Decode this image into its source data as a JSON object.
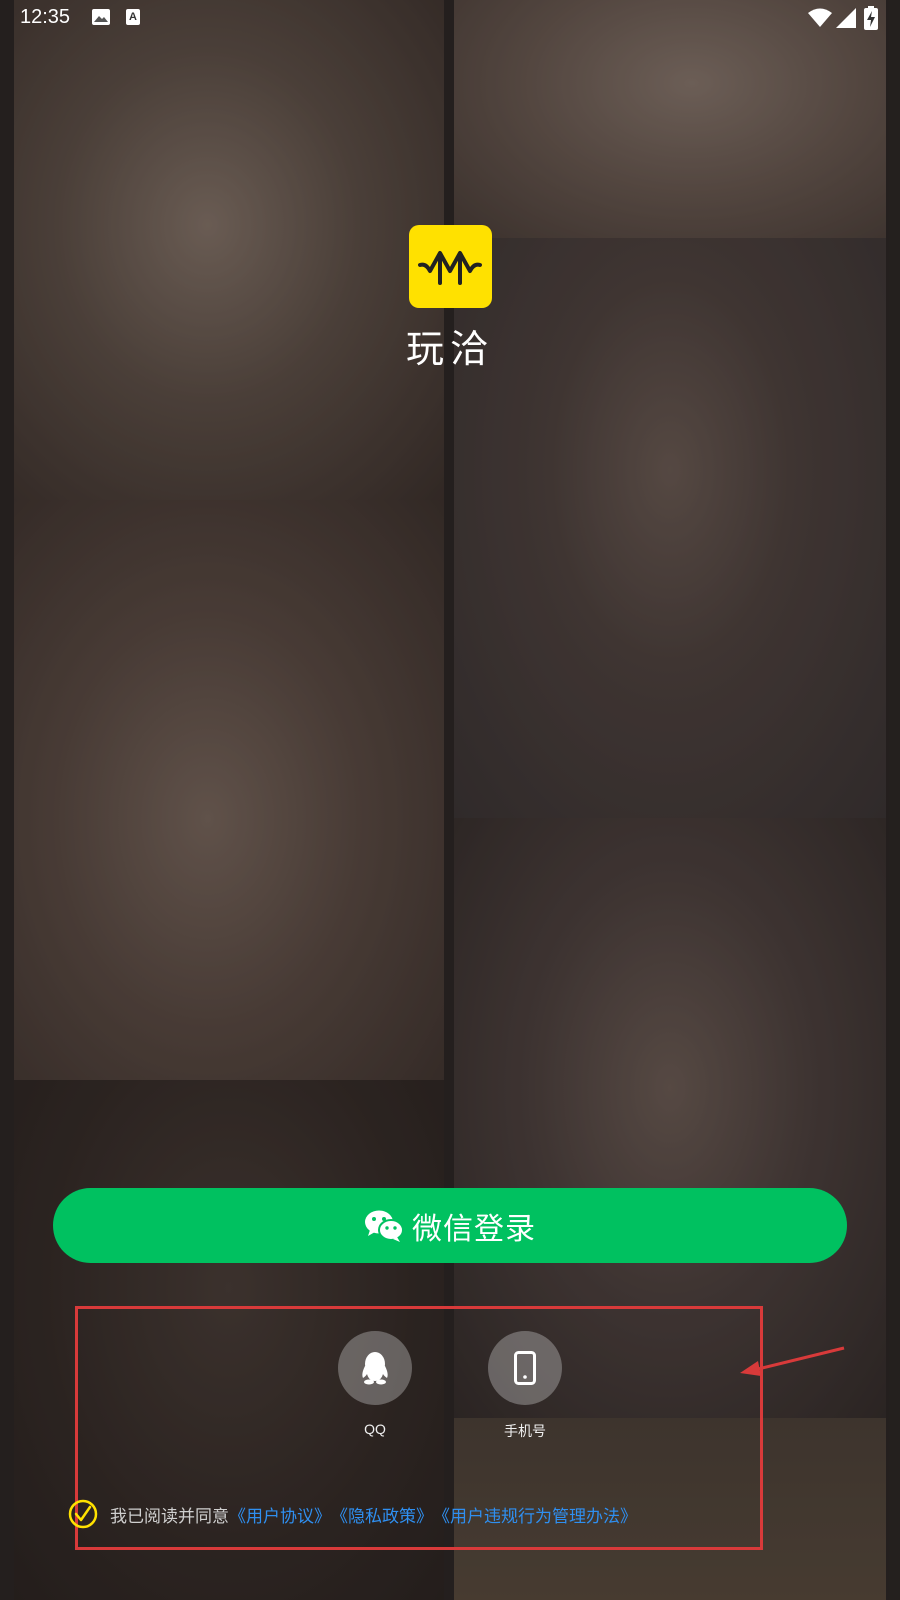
{
  "status_bar": {
    "time": "12:35",
    "icons": [
      "image-icon",
      "a-keyboard-icon",
      "wifi-icon",
      "signal-icon",
      "battery-charging-icon"
    ]
  },
  "app": {
    "name": "玩洽",
    "logo_color": "#ffe100"
  },
  "wechat_login": {
    "label": "微信登录",
    "color": "#00c160",
    "icon": "wechat-icon"
  },
  "alt_logins": [
    {
      "label": "QQ",
      "icon": "qq-penguin-icon"
    },
    {
      "label": "手机号",
      "icon": "phone-icon"
    }
  ],
  "agreement": {
    "prefix": "我已阅读并同意",
    "user_agreement": "《用户协议》",
    "privacy_policy": "《隐私政策》",
    "violation_rules": "《用户违规行为管理办法》",
    "checked": true,
    "check_color": "#ffe100",
    "link_color": "#2f8ff0"
  },
  "annotation": {
    "highlight_color": "#d83a3a"
  }
}
